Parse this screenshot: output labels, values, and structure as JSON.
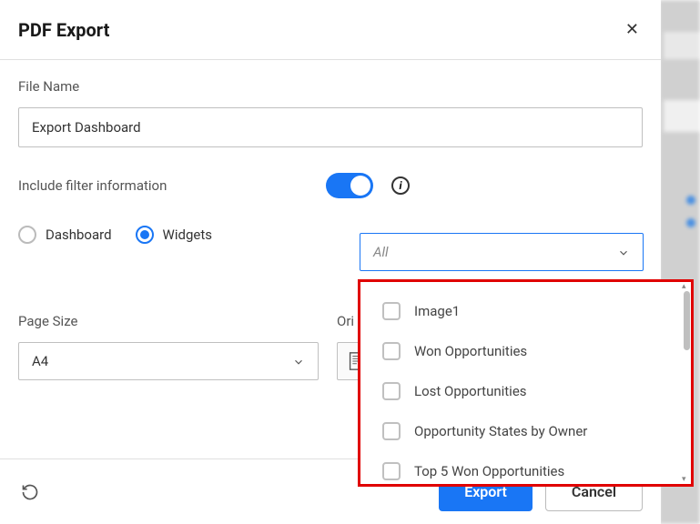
{
  "dialog": {
    "title": "PDF Export",
    "close_glyph": "✕"
  },
  "file_name": {
    "label": "File Name",
    "value": "Export Dashboard"
  },
  "filter_info": {
    "label": "Include filter information",
    "toggle_on": true,
    "info_glyph": "i"
  },
  "export_scope": {
    "dashboard_label": "Dashboard",
    "widgets_label": "Widgets",
    "selected": "widgets"
  },
  "widget_select": {
    "placeholder": "All",
    "options": [
      {
        "label": "Image1",
        "checked": false
      },
      {
        "label": "Won Opportunities",
        "checked": false
      },
      {
        "label": "Lost Opportunities",
        "checked": false
      },
      {
        "label": "Opportunity States by Owner",
        "checked": false
      },
      {
        "label": "Top 5 Won Opportunities",
        "checked": false
      }
    ]
  },
  "page_size": {
    "label": "Page Size",
    "value": "A4"
  },
  "orientation": {
    "label_short": "Ori",
    "selected": "portrait"
  },
  "footer": {
    "export_label": "Export",
    "cancel_label": "Cancel"
  }
}
